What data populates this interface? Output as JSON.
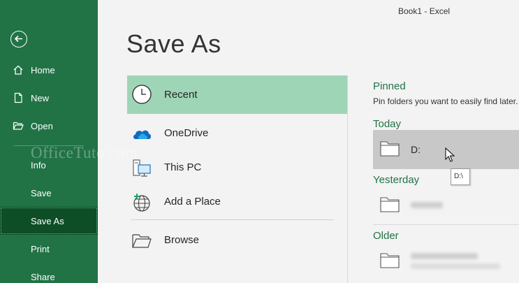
{
  "window": {
    "title": "Book1  -  Excel"
  },
  "page": {
    "title": "Save As"
  },
  "nav": {
    "back_label": "Back",
    "items": [
      {
        "label": "Home",
        "icon": "home-icon"
      },
      {
        "label": "New",
        "icon": "new-document-icon"
      },
      {
        "label": "Open",
        "icon": "open-folder-icon"
      },
      {
        "label": "Info"
      },
      {
        "label": "Save"
      },
      {
        "label": "Save As",
        "active": true
      },
      {
        "label": "Print"
      },
      {
        "label": "Share"
      }
    ]
  },
  "watermark": "OfficeTuto.com",
  "locations": [
    {
      "label": "Recent",
      "icon": "clock-icon",
      "active": true
    },
    {
      "label": "OneDrive",
      "icon": "onedrive-cloud-icon"
    },
    {
      "label": "This PC",
      "icon": "computer-icon"
    },
    {
      "label": "Add a Place",
      "icon": "globe-add-icon"
    },
    {
      "label": "Browse",
      "icon": "open-folder-icon"
    }
  ],
  "recent": {
    "pinned_title": "Pinned",
    "pinned_subtitle": "Pin folders you want to easily find later.",
    "groups": [
      {
        "title": "Today",
        "folders": [
          {
            "name": "D:",
            "tooltip": "D:\\",
            "hovered": true
          }
        ]
      },
      {
        "title": "Yesterday",
        "folders": [
          {
            "name": "",
            "redacted": true
          }
        ]
      },
      {
        "title": "Older",
        "folders": [
          {
            "name": "",
            "redacted": true
          }
        ]
      }
    ]
  },
  "colors": {
    "nav_bg": "#217346",
    "nav_active": "#0e4e27",
    "location_active": "#9fd5b7",
    "accent_text": "#217346",
    "hover_row": "#c8c8c8"
  }
}
